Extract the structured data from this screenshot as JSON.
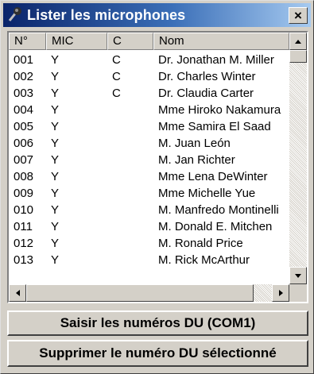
{
  "window": {
    "title": "Lister les microphones",
    "close_label": "×"
  },
  "columns": [
    "N°",
    "MIC",
    "C",
    "Nom"
  ],
  "rows": [
    {
      "num": "001",
      "mic": "Y",
      "c": "C",
      "nom": "Dr. Jonathan M. Miller"
    },
    {
      "num": "002",
      "mic": "Y",
      "c": "C",
      "nom": "Dr. Charles Winter"
    },
    {
      "num": "003",
      "mic": "Y",
      "c": "C",
      "nom": "Dr. Claudia Carter"
    },
    {
      "num": "004",
      "mic": "Y",
      "c": "",
      "nom": "Mme Hiroko Nakamura"
    },
    {
      "num": "005",
      "mic": "Y",
      "c": "",
      "nom": "Mme Samira El Saad"
    },
    {
      "num": "006",
      "mic": "Y",
      "c": "",
      "nom": "M. Juan León"
    },
    {
      "num": "007",
      "mic": "Y",
      "c": "",
      "nom": "M. Jan Richter"
    },
    {
      "num": "008",
      "mic": "Y",
      "c": "",
      "nom": "Mme Lena DeWinter"
    },
    {
      "num": "009",
      "mic": "Y",
      "c": "",
      "nom": "Mme Michelle Yue"
    },
    {
      "num": "010",
      "mic": "Y",
      "c": "",
      "nom": "M. Manfredo Montinelli"
    },
    {
      "num": "011",
      "mic": "Y",
      "c": "",
      "nom": "M. Donald E. Mitchen"
    },
    {
      "num": "012",
      "mic": "Y",
      "c": "",
      "nom": "M. Ronald Price"
    },
    {
      "num": "013",
      "mic": "Y",
      "c": "",
      "nom": "M. Rick McArthur"
    }
  ],
  "buttons": {
    "capture": "Saisir les numéros DU (COM1)",
    "delete": "Supprimer le numéro DU sélectionné"
  },
  "icons": {
    "title": "microphone-icon",
    "close": "close-icon",
    "scroll_up": "arrow-up-icon",
    "scroll_down": "arrow-down-icon",
    "scroll_left": "arrow-left-icon",
    "scroll_right": "arrow-right-icon"
  },
  "colors": {
    "titlebar_start": "#0a246a",
    "titlebar_end": "#a6caf0",
    "face": "#d4d0c8"
  }
}
